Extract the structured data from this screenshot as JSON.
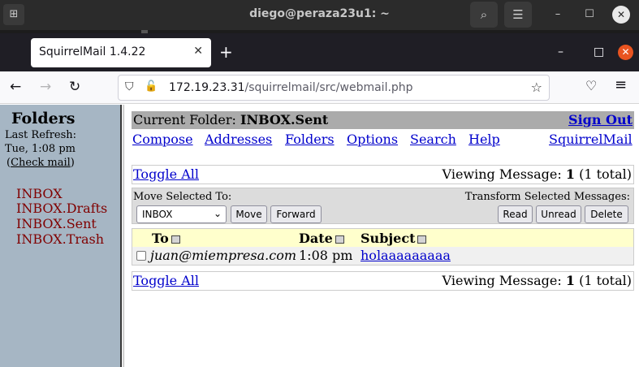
{
  "os": {
    "title": "diego@peraza23u1: ~",
    "new_terminal_glyph": "⊞",
    "search_glyph": "⌕",
    "menu_glyph": "☰",
    "minimize_glyph": "–",
    "maximize_glyph": "☐",
    "close_glyph": "✕"
  },
  "browser": {
    "tab_title": "SquirrelMail 1.4.22",
    "tab_close": "✕",
    "new_tab": "+",
    "url_host": "172.19.23.31",
    "url_path": "/squirrelmail/src/webmail.php",
    "back": "←",
    "forward": "→",
    "reload": "↻",
    "shield": "⛉",
    "lock": "🔓",
    "star": "☆",
    "pocket": "♡",
    "menu": "≡",
    "win_minimize": "–",
    "win_maximize": "□",
    "win_close": "✕"
  },
  "left": {
    "title": "Folders",
    "last_refresh_label": "Last Refresh:",
    "last_refresh_time": "Tue, 1:08 pm",
    "check_mail_open": "(",
    "check_mail": "Check mail",
    "check_mail_close": ")",
    "folders": [
      "INBOX",
      "INBOX.Drafts",
      "INBOX.Sent",
      "INBOX.Trash"
    ]
  },
  "main": {
    "current_folder_label": "Current Folder:",
    "current_folder": "INBOX.Sent",
    "sign_out": "Sign Out",
    "menu": [
      "Compose",
      "Addresses",
      "Folders",
      "Options",
      "Search",
      "Help"
    ],
    "brand_link": "SquirrelMail",
    "toggle_all": "Toggle All",
    "viewing_label": "Viewing Message:",
    "viewing_number": "1",
    "viewing_total": "(1 total)",
    "move_selected_label": "Move Selected To:",
    "transform_label": "Transform Selected Messages:",
    "move_select_value": "INBOX",
    "move_button": "Move",
    "forward_button": "Forward",
    "read_button": "Read",
    "unread_button": "Unread",
    "delete_button": "Delete",
    "columns": [
      "To",
      "Date",
      "Subject"
    ],
    "rows": [
      {
        "to": "juan@miempresa.com",
        "date": "1:08 pm",
        "subject": "holaaaaaaaaa",
        "checked": false
      }
    ]
  }
}
